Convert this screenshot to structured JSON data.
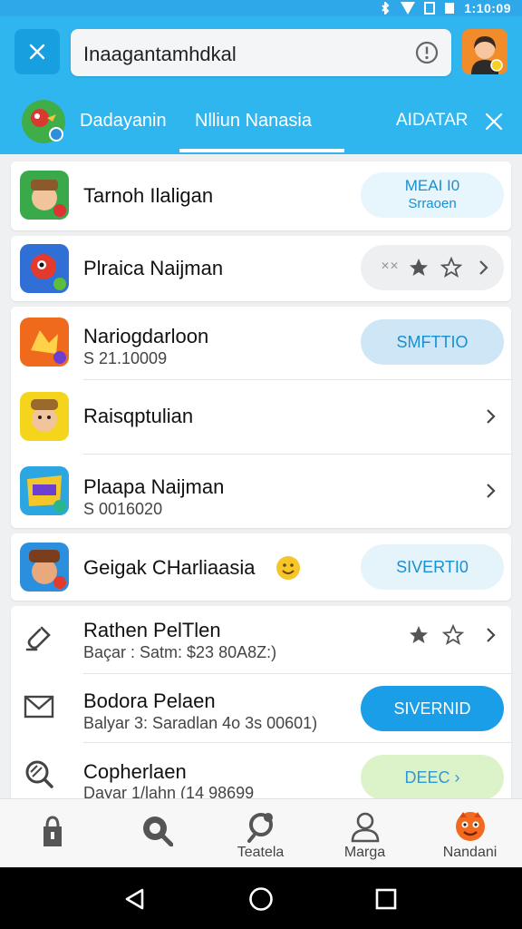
{
  "status_bar": {
    "time": "1:10:09"
  },
  "header": {
    "search_value": "Inaagantamhdkal",
    "tabs": [
      {
        "label": "Dadayanin"
      },
      {
        "label": "Nlliun Nanasia"
      },
      {
        "label": "AIDATAR"
      }
    ],
    "active_tab": 1
  },
  "list": {
    "rows": [
      {
        "title": "Tarnoh Ilaligan",
        "subtitle": "",
        "action": {
          "type": "pill",
          "line1": "MEAI I0",
          "line2": "Srraoen"
        }
      },
      {
        "title": "Plraica Naijman",
        "subtitle": "",
        "action": {
          "type": "rating",
          "text": "✕✕"
        }
      },
      {
        "title": "Nariogdarloon",
        "subtitle": "S 21.10009",
        "action": {
          "type": "pill",
          "line1": "SMFTTIO"
        }
      },
      {
        "title": "Raisqptulian",
        "subtitle": "",
        "action": {
          "type": "chevron"
        }
      },
      {
        "title": "Plaapa Naijman",
        "subtitle": "S 0016020",
        "action": {
          "type": "chevron"
        }
      },
      {
        "title": "Geigak CHarliaasia",
        "subtitle": "",
        "action": {
          "type": "pill",
          "line1": "SIVERTI0"
        }
      },
      {
        "title": "Rathen PelTlen",
        "subtitle": "Baçar : Satm: $23 80A8Z:)",
        "action": {
          "type": "rating"
        }
      },
      {
        "title": "Bodora Pelaen",
        "subtitle": "Balyar 3: Saradlan 4o 3s 00601)",
        "action": {
          "type": "pill",
          "line1": "SIVERNID"
        }
      },
      {
        "title": "Copherlaen",
        "subtitle": "Dayar 1/lahn (14 98699",
        "action": {
          "type": "pill",
          "line1": "DEEC ›"
        }
      }
    ]
  },
  "bottom_nav": {
    "items": [
      {
        "label": ""
      },
      {
        "label": ""
      },
      {
        "label": "Teatela"
      },
      {
        "label": "Marga"
      },
      {
        "label": "Nandani"
      }
    ]
  },
  "colors": {
    "header_blue": "#2fb6ef",
    "accent_blue": "#1a9ee8"
  }
}
